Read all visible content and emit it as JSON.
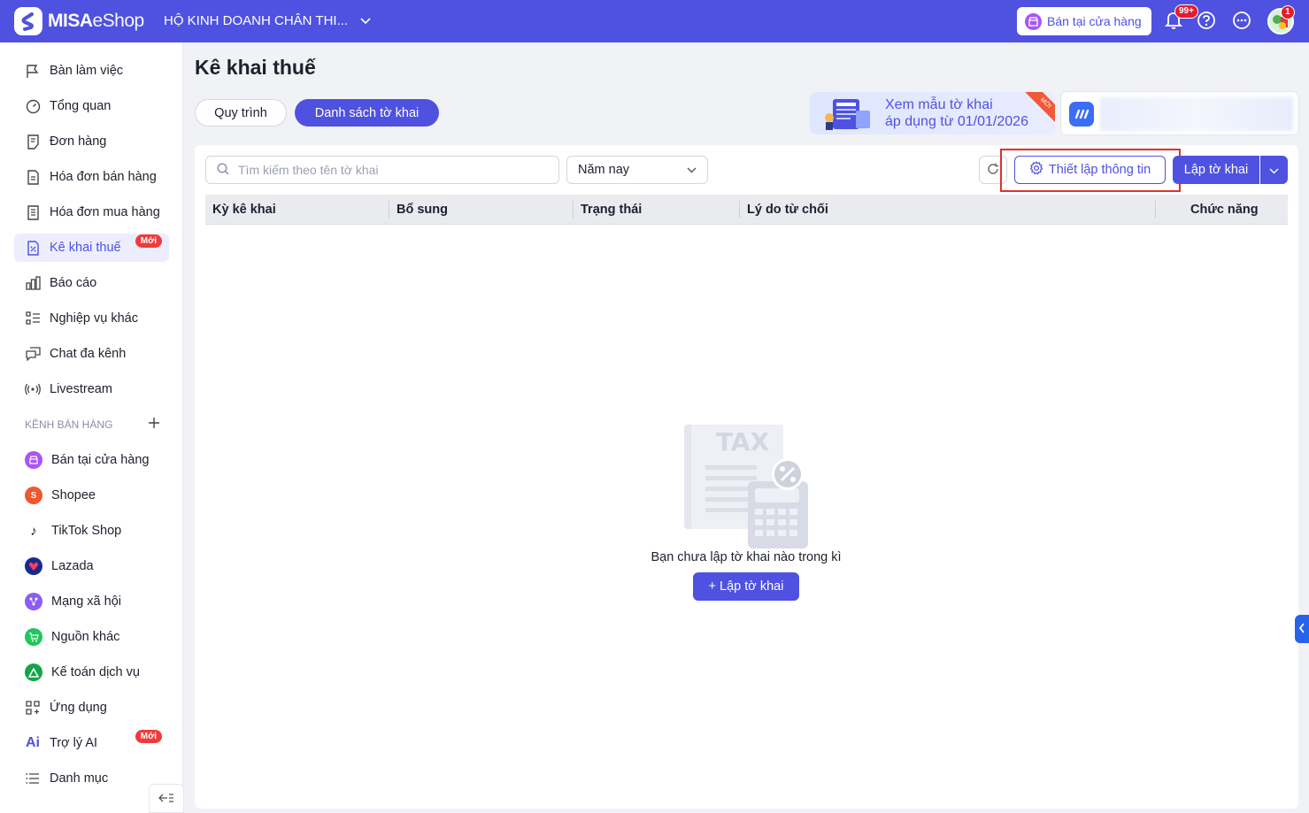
{
  "app": {
    "logo_main": "MISA",
    "logo_sub": "eShop",
    "business_name": "HỘ KINH DOANH CHÂN THI...",
    "store_button": "Bán tại cửa hàng",
    "notification_count": "99+",
    "avatar_badge": "1"
  },
  "sidebar": {
    "items": [
      {
        "label": "Bàn làm việc"
      },
      {
        "label": "Tổng quan"
      },
      {
        "label": "Đơn hàng"
      },
      {
        "label": "Hóa đơn bán hàng"
      },
      {
        "label": "Hóa đơn mua hàng"
      },
      {
        "label": "Kê khai thuế",
        "tag": "Mới"
      },
      {
        "label": "Báo cáo"
      },
      {
        "label": "Nghiệp vụ khác"
      },
      {
        "label": "Chat đa kênh"
      },
      {
        "label": "Livestream"
      }
    ],
    "section_label": "KÊNH BÁN HÀNG",
    "channels": [
      {
        "label": "Bán tại cửa hàng",
        "color": "#a855f7"
      },
      {
        "label": "Shopee",
        "color": "#f0572d"
      },
      {
        "label": "TikTok Shop",
        "color": "#111111"
      },
      {
        "label": "Lazada",
        "color": "#1a2a8a"
      },
      {
        "label": "Mạng xã hội",
        "color": "#8b5cf6"
      },
      {
        "label": "Nguồn khác",
        "color": "#22c55e"
      },
      {
        "label": "Kế toán dịch vụ",
        "color": "#16a34a"
      }
    ],
    "bottom_items": [
      {
        "label": "Ứng dụng"
      },
      {
        "label": "Trợ lý AI",
        "tag": "Mới",
        "icon_text": "Ai"
      },
      {
        "label": "Danh mục"
      }
    ]
  },
  "page": {
    "title": "Kê khai thuế",
    "tabs": [
      {
        "label": "Quy trình"
      },
      {
        "label": "Danh sách tờ khai"
      }
    ],
    "promo": {
      "line1": "Xem mẫu tờ khai",
      "line2": "áp dụng từ 01/01/2026",
      "ribbon": "MỚI"
    }
  },
  "toolbar": {
    "search_placeholder": "Tìm kiếm theo tên tờ khai",
    "period_value": "Năm nay",
    "setup_label": "Thiết lập thông tin",
    "create_label": "Lập tờ khai"
  },
  "table": {
    "columns": [
      "Kỳ kê khai",
      "Bổ sung",
      "Trạng thái",
      "Lý do từ chối",
      "Chức năng"
    ]
  },
  "empty": {
    "illustration_text": "TAX",
    "message": "Bạn chưa lập tờ khai nào trong kì",
    "button_label": "+ Lập tờ khai"
  },
  "colors": {
    "brand": "#4f51e0",
    "highlight": "#e0312b",
    "new_tag": "#ef3b3b"
  }
}
